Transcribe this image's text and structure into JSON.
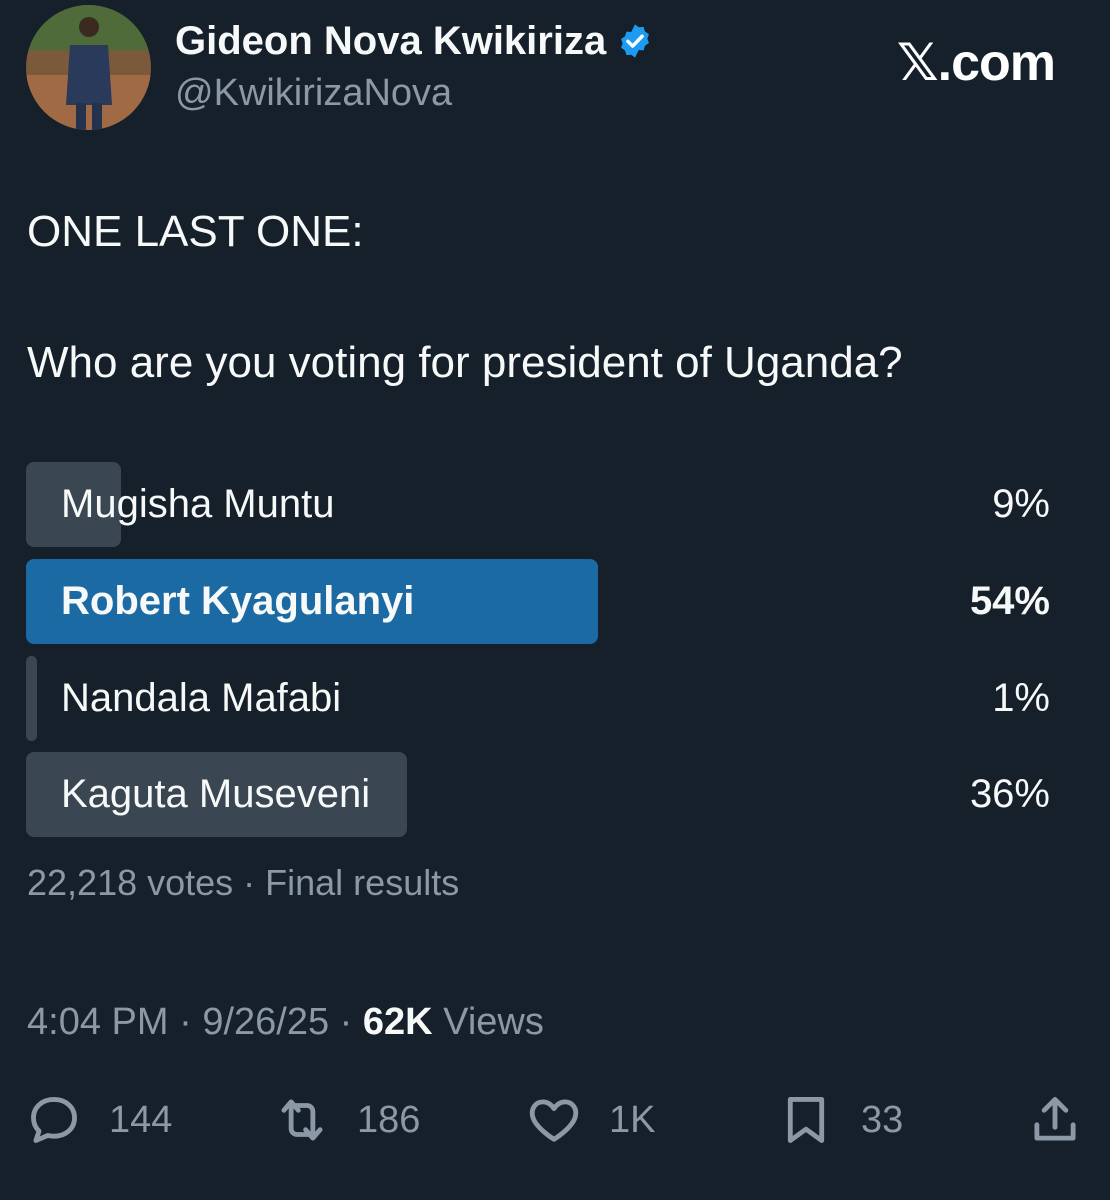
{
  "author": {
    "display_name": "Gideon Nova Kwikiriza",
    "handle": "@KwikirizaNova",
    "verified": true,
    "avatar_icon": "user-photo"
  },
  "watermark": "𝕏.com",
  "tweet": {
    "line1": "ONE LAST ONE:",
    "line2": "Who are you voting for president of Uganda?"
  },
  "poll": {
    "options": [
      {
        "label": "Mugisha Muntu",
        "percent_text": "9%",
        "percent": 9,
        "winner": false
      },
      {
        "label": "Robert Kyagulanyi",
        "percent_text": "54%",
        "percent": 54,
        "winner": true
      },
      {
        "label": "Nandala Mafabi",
        "percent_text": "1%",
        "percent": 1,
        "winner": false
      },
      {
        "label": "Kaguta Museveni",
        "percent_text": "36%",
        "percent": 36,
        "winner": false
      }
    ],
    "summary": "22,218 votes · Final results"
  },
  "meta": {
    "time": "4:04 PM",
    "date": "9/26/25",
    "views_count": "62K",
    "views_label": "Views"
  },
  "actions": {
    "replies": "144",
    "reposts": "186",
    "likes": "1K",
    "bookmarks": "33"
  },
  "colors": {
    "background": "#15202b",
    "verified": "#1d9bf0",
    "poll_bar": "#3a4753",
    "poll_winner": "#1c6aa3",
    "secondary_text": "#8b98a5"
  }
}
